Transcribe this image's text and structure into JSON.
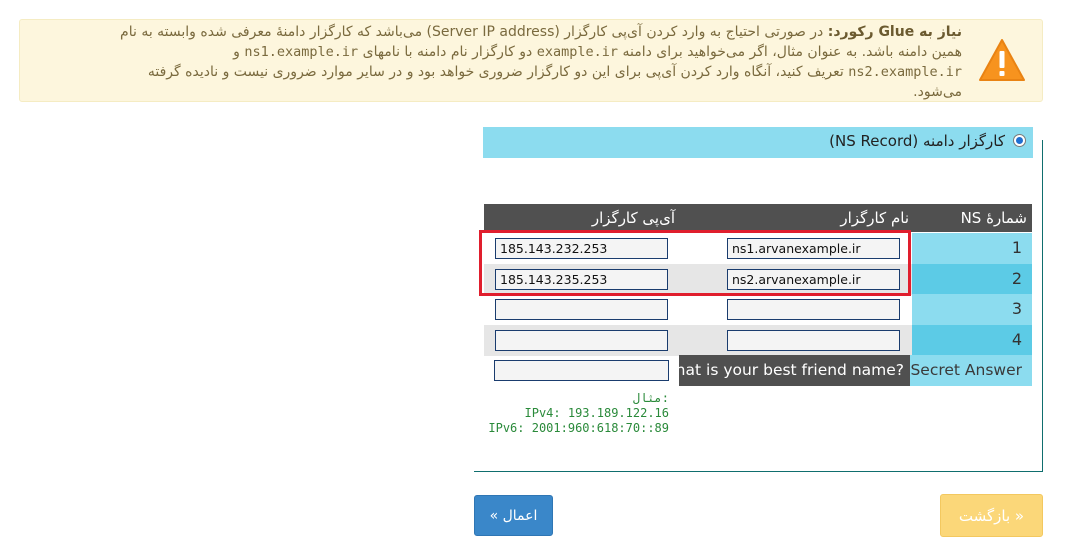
{
  "notice": {
    "title": "نیاز به Glue رکورد:",
    "line1_rest": " در صورتی احتیاج به وارد کردن آی‌پی کارگزار (Server IP address) می‌باشد که کارگزار دامنهٔ معرفی شده وابسته به نام",
    "line2_a": "همین دامنه باشد. به عنوان مثال، اگر می‌خواهید برای دامنه ",
    "line2_domain": "example.ir",
    "line2_b": " دو کارگزار نام دامنه با نامهای ",
    "line2_ns1": "ns1.example.ir",
    "line2_c": " و",
    "line3_ns2": "ns2.example.ir",
    "line3_a": " تعریف کنید، آنگاه وارد کردن آی‌پی برای این دو کارگزار ضروری خواهد بود و در سایر موارد ضروری نیست و نادیده گرفته",
    "line4": "می‌شود."
  },
  "section": {
    "label": "کارگزار دامنه (NS Record)"
  },
  "table": {
    "headers": {
      "ns_number": "شمارهٔ NS",
      "server_name": "نام کارگزار",
      "server_ip": "آی‌پی کارگزار"
    },
    "rows": [
      {
        "number": "1",
        "name": "ns1.arvanexample.ir",
        "ip": "185.143.232.253"
      },
      {
        "number": "2",
        "name": "ns2.arvanexample.ir",
        "ip": "185.143.235.253"
      },
      {
        "number": "3",
        "name": "",
        "ip": ""
      },
      {
        "number": "4",
        "name": "",
        "ip": ""
      }
    ]
  },
  "secret": {
    "label": "Secret Answer",
    "question": "What is your best friend name?",
    "answer": ""
  },
  "example": {
    "title": "مثال:",
    "ipv4": "IPv4: 193.189.122.16",
    "ipv6": "IPv6: 2001:960:618:70::89"
  },
  "buttons": {
    "apply": "اعمال »",
    "back": "« بازگشت"
  },
  "colors": {
    "accent_blue": "#3a87c9",
    "warning_bg": "#fdf6dd",
    "header_cyan": "#8cdcef",
    "highlight_red": "#e01e2d"
  }
}
